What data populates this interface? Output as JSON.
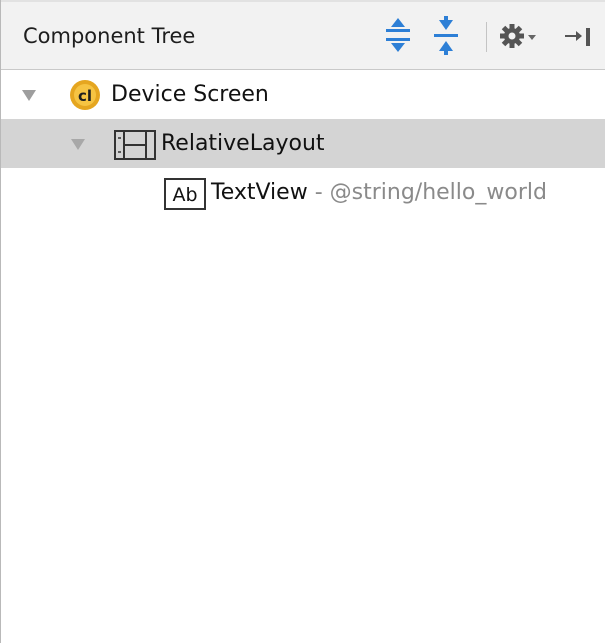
{
  "header": {
    "title": "Component Tree",
    "toolbar_icons": [
      "expand-all-icon",
      "collapse-all-icon",
      "settings-icon",
      "hide-panel-icon"
    ]
  },
  "tree": {
    "nodes": [
      {
        "label": "Device Screen",
        "icon": "device-screen-icon",
        "expanded": true
      },
      {
        "label": "RelativeLayout",
        "icon": "relative-layout-icon",
        "expanded": true,
        "selected": true
      },
      {
        "label": "TextView",
        "separator": " - ",
        "detail": "@string/hello_world",
        "icon": "textview-icon",
        "icon_text": "Ab"
      }
    ]
  },
  "colors": {
    "accent": "#2d7fd6",
    "selection": "#d4d4d4",
    "device_icon": "#e5a620"
  }
}
